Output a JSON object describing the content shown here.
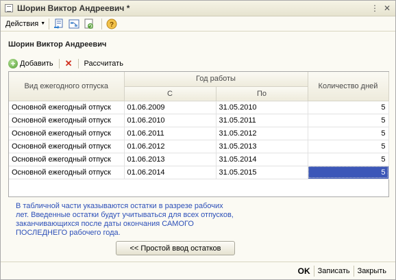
{
  "window": {
    "title": "Шорин Виктор Андреевич *"
  },
  "toolbar": {
    "actions_label": "Действия"
  },
  "form": {
    "heading": "Шорин Виктор Андреевич"
  },
  "commands": {
    "add_label": "Добавить",
    "calc_label": "Рассчитать"
  },
  "table": {
    "columns": {
      "vacation_type": "Вид ежегодного отпуска",
      "work_year": "Год работы",
      "from": "С",
      "to": "По",
      "days": "Количество дней"
    },
    "rows": [
      {
        "type": "Основной ежегодный отпуск",
        "from": "01.06.2009",
        "to": "31.05.2010",
        "days": "5"
      },
      {
        "type": "Основной ежегодный отпуск",
        "from": "01.06.2010",
        "to": "31.05.2011",
        "days": "5"
      },
      {
        "type": "Основной ежегодный отпуск",
        "from": "01.06.2011",
        "to": "31.05.2012",
        "days": "5"
      },
      {
        "type": "Основной ежегодный отпуск",
        "from": "01.06.2012",
        "to": "31.05.2013",
        "days": "5"
      },
      {
        "type": "Основной ежегодный отпуск",
        "from": "01.06.2013",
        "to": "31.05.2014",
        "days": "5"
      },
      {
        "type": "Основной ежегодный отпуск",
        "from": "01.06.2014",
        "to": "31.05.2015",
        "days": "5"
      }
    ]
  },
  "info": {
    "line1": "В табличной части указываются остатки в разрезе рабочих",
    "line2": "лет. Введенные остатки будут учитываться для всех отпусков,",
    "line3": "заканчивающихся после даты окончания САМОГО",
    "line4": "ПОСЛЕДНЕГО рабочего года."
  },
  "simple_input_button": "<< Простой ввод остатков",
  "bottom": {
    "ok": "OK",
    "save": "Записать",
    "close": "Закрыть"
  }
}
